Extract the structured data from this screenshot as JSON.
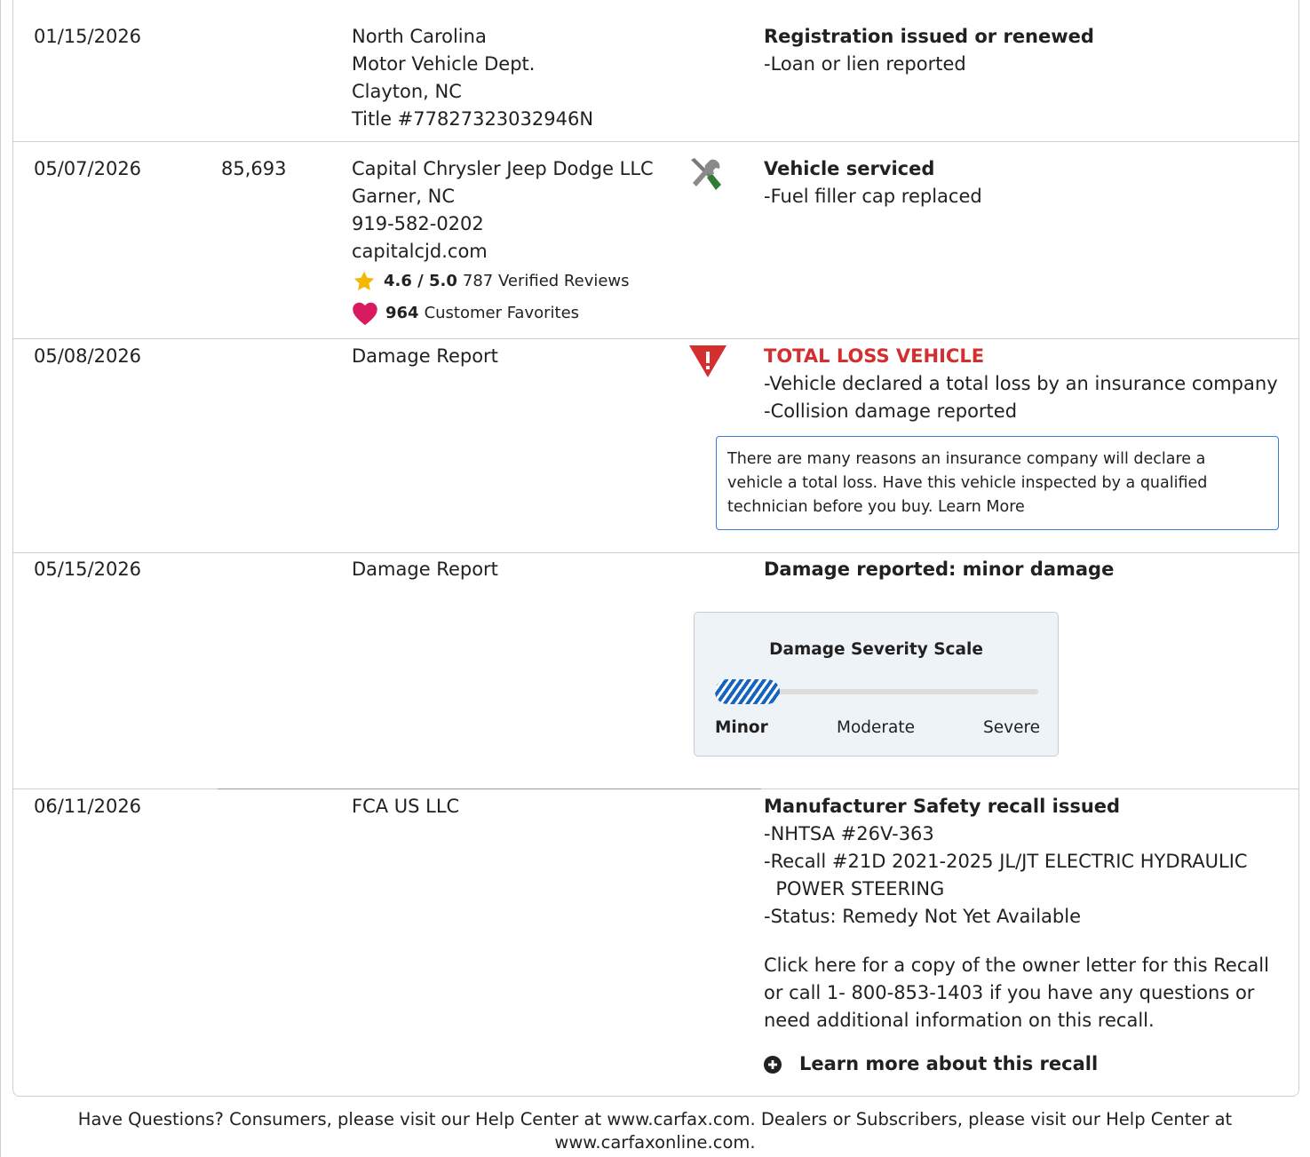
{
  "rows": [
    {
      "date": "01/15/2026",
      "mileage": "",
      "source": [
        "North Carolina",
        "Motor Vehicle Dept.",
        "Clayton, NC",
        "Title #77827323032946N"
      ],
      "comments_header": "Registration issued or renewed",
      "comments": [
        "-Loan or lien reported"
      ]
    },
    {
      "date": "05/07/2026",
      "mileage": "85,693",
      "source": [
        "Capital Chrysler Jeep Dodge LLC",
        "Garner, NC",
        "919-582-0202",
        "capitalcjd.com"
      ],
      "rating": {
        "score": "4.6 / 5.0",
        "text": "787 Verified Reviews"
      },
      "favorites": {
        "count": "964",
        "text": "Customer Favorites"
      },
      "icon": "service-tools-icon",
      "comments_header": "Vehicle serviced",
      "comments": [
        "-Fuel filler cap replaced"
      ]
    },
    {
      "date": "05/08/2026",
      "mileage": "",
      "source": [
        "Damage Report"
      ],
      "icon": "warning-triangle-icon",
      "comments_header": "TOTAL LOSS VEHICLE",
      "comments": [
        "-Vehicle declared a total loss by an insurance company",
        "-Collision damage reported"
      ],
      "notice": [
        "There are many reasons an insurance company will declare a",
        "vehicle a total loss. Have this vehicle inspected by a qualified",
        "technician before you buy. Learn More"
      ]
    },
    {
      "date": "05/15/2026",
      "mileage": "",
      "source": [
        "Damage Report"
      ],
      "comments_header": "Damage reported: minor damage",
      "severity": {
        "title": "Damage Severity Scale",
        "labels": [
          "Minor",
          "Moderate",
          "Severe"
        ],
        "selected": "Minor",
        "level": 0.2
      }
    },
    {
      "date": "06/11/2026",
      "mileage": "",
      "source": [
        "FCA US LLC"
      ],
      "comments_header": "Manufacturer Safety recall issued",
      "comments": [
        "-NHTSA #26V-363",
        "-Recall #21D 2021-2025 JL/JT ELECTRIC HYDRAULIC",
        "  POWER STEERING",
        "-Status: Remedy Not Yet Available"
      ],
      "owner_letter": [
        "Click here for a copy of the owner letter for this Recall",
        "or call 1- 800-853-1403 if you have any questions or",
        "need additional information on this recall."
      ],
      "learn_more": "Learn more about this recall"
    }
  ],
  "footer": [
    "Have Questions? Consumers, please visit our Help Center at www.carfax.com. Dealers or Subscribers, please visit our Help Center at",
    "www.carfaxonline.com."
  ],
  "colors": {
    "alert_red": "#d32f2f",
    "star": "#f5b800",
    "heart": "#d81b60",
    "severity_blue": "#1565c0",
    "border": "#cfcfcf"
  }
}
